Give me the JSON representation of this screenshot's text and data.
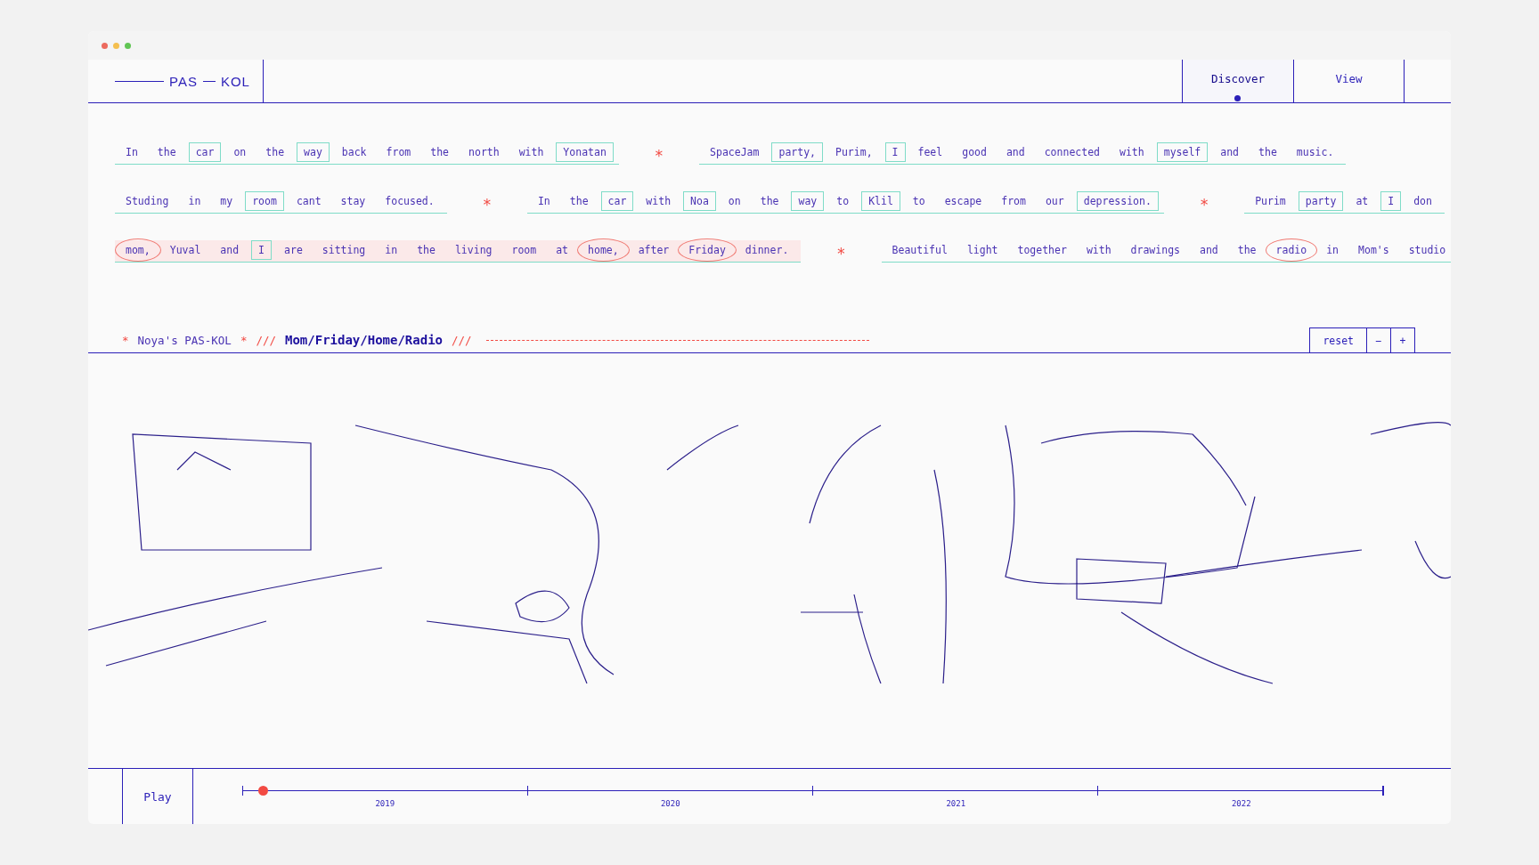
{
  "window": {
    "controls": [
      {
        "color": "#ec6a5e"
      },
      {
        "color": "#f4bf4f"
      },
      {
        "color": "#61c554"
      }
    ]
  },
  "logo": {
    "left": "PAS",
    "right": "KOL"
  },
  "nav": [
    {
      "label": "Discover",
      "selected": true
    },
    {
      "label": "View",
      "selected": false
    }
  ],
  "sentence_rows": [
    {
      "sentences": [
        {
          "highlighted": false,
          "words": [
            {
              "text": "In",
              "kind": "plain"
            },
            {
              "text": "the",
              "kind": "plain"
            },
            {
              "text": "car",
              "kind": "boxed"
            },
            {
              "text": "on",
              "kind": "plain"
            },
            {
              "text": "the",
              "kind": "plain"
            },
            {
              "text": "way",
              "kind": "boxed"
            },
            {
              "text": "back",
              "kind": "plain"
            },
            {
              "text": "from",
              "kind": "plain"
            },
            {
              "text": "the",
              "kind": "plain"
            },
            {
              "text": "north",
              "kind": "plain"
            },
            {
              "text": "with",
              "kind": "plain"
            },
            {
              "text": "Yonatan",
              "kind": "boxed"
            }
          ]
        },
        {
          "highlighted": false,
          "words": [
            {
              "text": "SpaceJam",
              "kind": "plain"
            },
            {
              "text": "party,",
              "kind": "boxed"
            },
            {
              "text": "Purim,",
              "kind": "plain"
            },
            {
              "text": "I",
              "kind": "boxed"
            },
            {
              "text": "feel",
              "kind": "plain"
            },
            {
              "text": "good",
              "kind": "plain"
            },
            {
              "text": "and",
              "kind": "plain"
            },
            {
              "text": "connected",
              "kind": "plain"
            },
            {
              "text": "with",
              "kind": "plain"
            },
            {
              "text": "myself",
              "kind": "boxed"
            },
            {
              "text": "and",
              "kind": "plain"
            },
            {
              "text": "the",
              "kind": "plain"
            },
            {
              "text": "music.",
              "kind": "plain"
            }
          ]
        }
      ],
      "separator": "*"
    },
    {
      "sentences": [
        {
          "highlighted": false,
          "words": [
            {
              "text": "Studing",
              "kind": "plain"
            },
            {
              "text": "in",
              "kind": "plain"
            },
            {
              "text": "my",
              "kind": "plain"
            },
            {
              "text": "room",
              "kind": "boxed"
            },
            {
              "text": "cant",
              "kind": "plain"
            },
            {
              "text": "stay",
              "kind": "plain"
            },
            {
              "text": "focused.",
              "kind": "plain"
            }
          ]
        },
        {
          "highlighted": false,
          "words": [
            {
              "text": "In",
              "kind": "plain"
            },
            {
              "text": "the",
              "kind": "plain"
            },
            {
              "text": "car",
              "kind": "boxed"
            },
            {
              "text": "with",
              "kind": "plain"
            },
            {
              "text": "Noa",
              "kind": "boxed"
            },
            {
              "text": "on",
              "kind": "plain"
            },
            {
              "text": "the",
              "kind": "plain"
            },
            {
              "text": "way",
              "kind": "boxed"
            },
            {
              "text": "to",
              "kind": "plain"
            },
            {
              "text": "Klil",
              "kind": "boxed"
            },
            {
              "text": "to",
              "kind": "plain"
            },
            {
              "text": "escape",
              "kind": "plain"
            },
            {
              "text": "from",
              "kind": "plain"
            },
            {
              "text": "our",
              "kind": "plain"
            },
            {
              "text": "depression.",
              "kind": "boxed"
            }
          ]
        },
        {
          "highlighted": false,
          "words": [
            {
              "text": "Purim",
              "kind": "plain"
            },
            {
              "text": "party",
              "kind": "boxed"
            },
            {
              "text": "at",
              "kind": "plain"
            },
            {
              "text": "I",
              "kind": "boxed"
            },
            {
              "text": "don",
              "kind": "plain"
            }
          ]
        }
      ],
      "separator": "*"
    },
    {
      "sentences": [
        {
          "highlighted": true,
          "words": [
            {
              "text": "mom,",
              "kind": "circled"
            },
            {
              "text": "Yuval",
              "kind": "plain"
            },
            {
              "text": "and",
              "kind": "plain"
            },
            {
              "text": "I",
              "kind": "boxed"
            },
            {
              "text": "are",
              "kind": "plain"
            },
            {
              "text": "sitting",
              "kind": "plain"
            },
            {
              "text": "in",
              "kind": "plain"
            },
            {
              "text": "the",
              "kind": "plain"
            },
            {
              "text": "living",
              "kind": "plain"
            },
            {
              "text": "room",
              "kind": "plain"
            },
            {
              "text": "at",
              "kind": "plain"
            },
            {
              "text": "home,",
              "kind": "circled"
            },
            {
              "text": "after",
              "kind": "plain"
            },
            {
              "text": "Friday",
              "kind": "circled"
            },
            {
              "text": "dinner.",
              "kind": "plain"
            }
          ]
        },
        {
          "highlighted": false,
          "words": [
            {
              "text": "Beautiful",
              "kind": "plain"
            },
            {
              "text": "light",
              "kind": "plain"
            },
            {
              "text": "together",
              "kind": "plain"
            },
            {
              "text": "with",
              "kind": "plain"
            },
            {
              "text": "drawings",
              "kind": "plain"
            },
            {
              "text": "and",
              "kind": "plain"
            },
            {
              "text": "the",
              "kind": "plain"
            },
            {
              "text": "radio",
              "kind": "circled"
            },
            {
              "text": "in",
              "kind": "plain"
            },
            {
              "text": "Mom's",
              "kind": "plain"
            },
            {
              "text": "studio",
              "kind": "plain"
            }
          ]
        }
      ],
      "separator": "*"
    }
  ],
  "selection_bar": {
    "star_left": "*",
    "owner": "Noya's PAS-KOL",
    "star_right": "*",
    "slashes_left": "///",
    "title": "Mom/Friday/Home/Radio",
    "slashes_right": "///",
    "buttons": [
      "reset",
      "−",
      "+"
    ]
  },
  "player": {
    "play": "Play",
    "years": [
      "2019",
      "2020",
      "2021",
      "2022"
    ],
    "playhead": {
      "level": 0.017
    }
  }
}
